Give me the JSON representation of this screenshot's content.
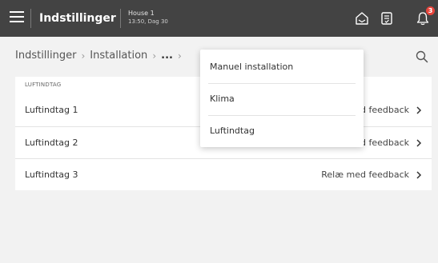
{
  "header": {
    "title": "Indstillinger",
    "house_name": "House 1",
    "house_time": "13:50, Dag 30",
    "notification_count": "3",
    "icons": {
      "menu": "hamburger-icon",
      "home": "home-icon",
      "tasks": "clipboard-icon",
      "notifications": "bell-icon"
    }
  },
  "breadcrumb": {
    "items": [
      "Indstillinger",
      "Installation",
      "..."
    ],
    "separator": "›"
  },
  "section": {
    "label": "LUFTINDTAG",
    "rows": [
      {
        "label": "Luftindtag 1",
        "value": "Relæ med feedback"
      },
      {
        "label": "Luftindtag 2",
        "value": "Relæ med feedback"
      },
      {
        "label": "Luftindtag 3",
        "value": "Relæ med feedback"
      }
    ]
  },
  "dropdown": {
    "items": [
      "Manuel installation",
      "Klima",
      "Luftindtag"
    ]
  },
  "colors": {
    "header_bg": "#434343",
    "page_bg": "#f2f2f2",
    "badge": "#e8453c"
  }
}
